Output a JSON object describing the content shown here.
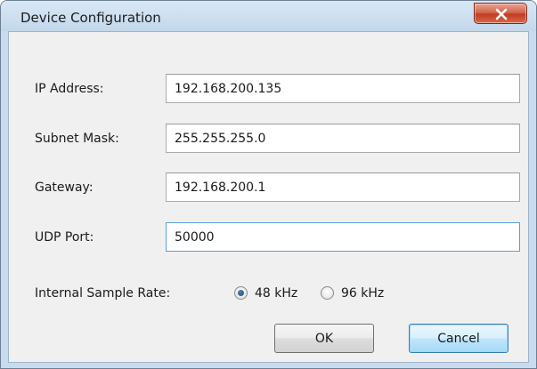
{
  "window": {
    "title": "Device Configuration",
    "close_glyph": "X"
  },
  "fields": [
    {
      "label": "IP Address:",
      "value": "192.168.200.135"
    },
    {
      "label": "Subnet Mask:",
      "value": "255.255.255.0"
    },
    {
      "label": "Gateway:",
      "value": "192.168.200.1"
    },
    {
      "label": "UDP Port:",
      "value": "50000"
    }
  ],
  "sample_rate": {
    "label": "Internal Sample Rate:",
    "options": [
      {
        "label": "48 kHz",
        "selected": true
      },
      {
        "label": "96 kHz",
        "selected": false
      }
    ]
  },
  "buttons": {
    "ok": "OK",
    "cancel": "Cancel"
  },
  "colors": {
    "close_button": "#c23c20",
    "focus_border": "#5b9fd6",
    "default_button": "#bee6fd"
  },
  "icons": {
    "close": "close-icon",
    "radio_selected": "radio-selected",
    "radio_unselected": "radio-unselected"
  }
}
